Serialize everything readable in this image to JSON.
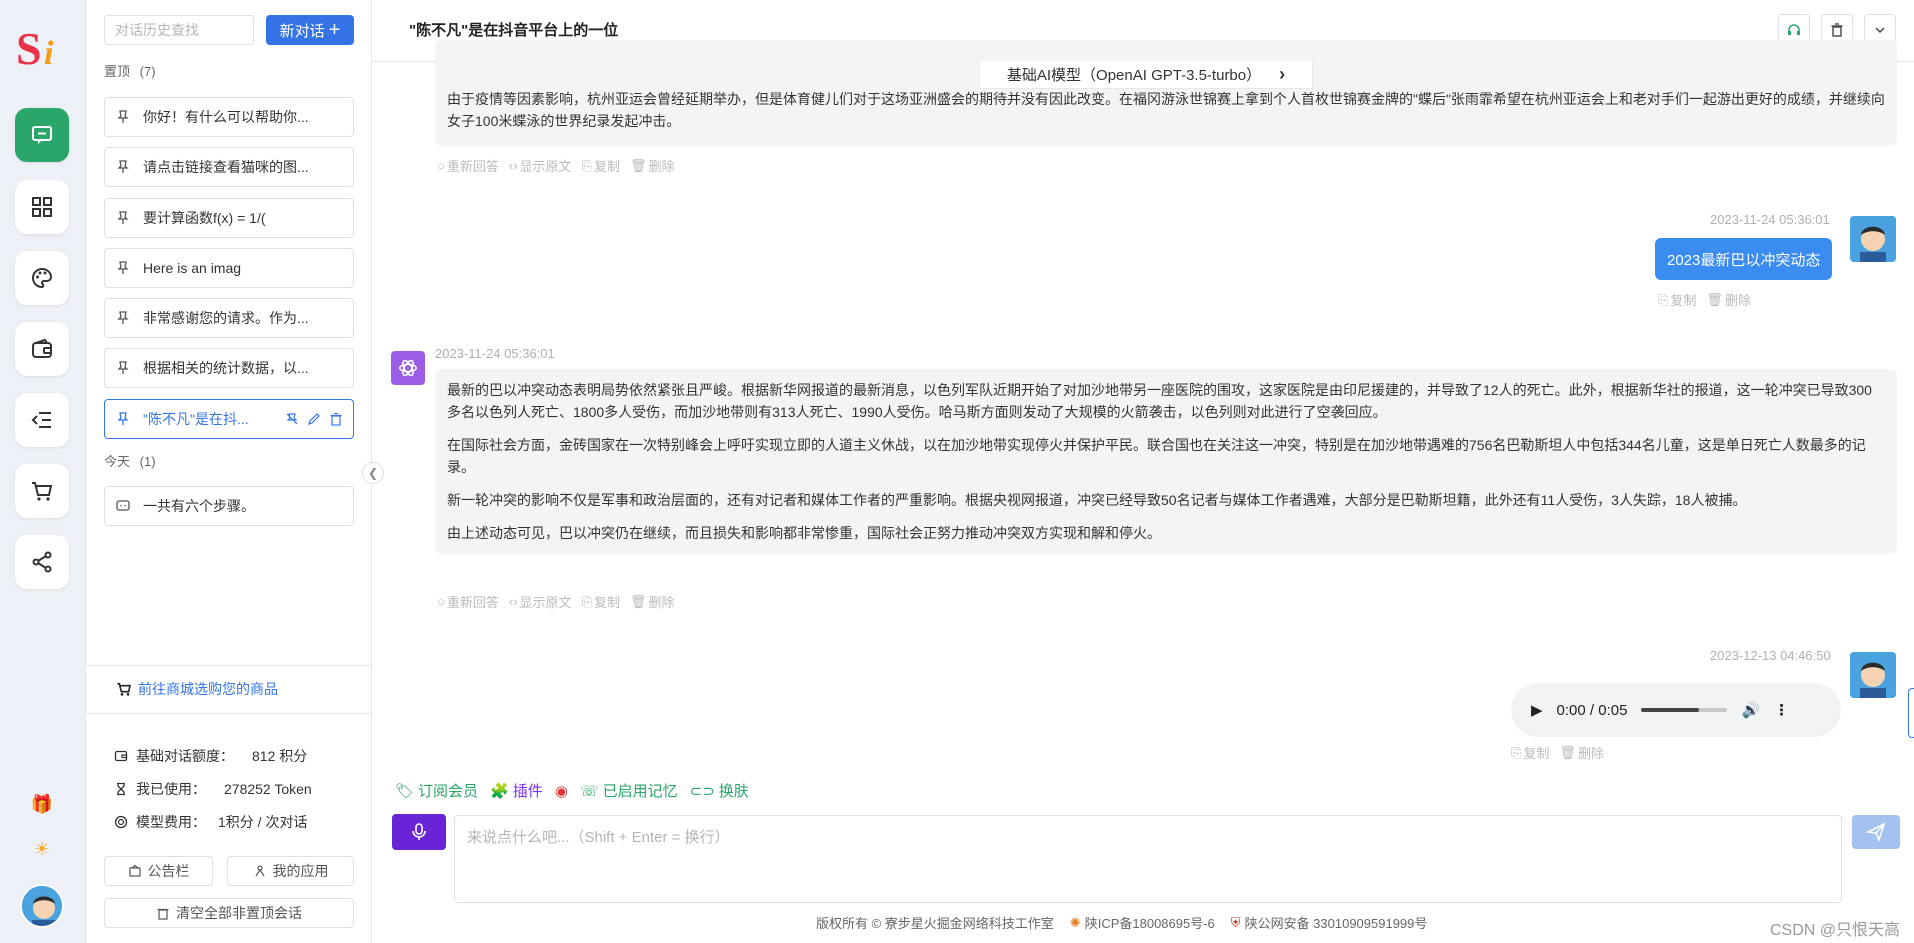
{
  "sidebar": {
    "search_placeholder": "对话历史查找",
    "new_chat_label": "新对话",
    "pinned_label": "置顶",
    "pinned_count": "(7)",
    "pinned": [
      "你好！有什么可以帮助你...",
      "请点击链接查看猫咪的图...",
      "要计算函数f(x) = 1/(",
      "Here is an imag",
      "非常感谢您的请求。作为...",
      "根据相关的统计数据，以...",
      "\"陈不凡\"是在抖..."
    ],
    "today_label": "今天",
    "today_count": "(1)",
    "today": [
      "一共有六个步骤。"
    ],
    "shop_link": "前往商城选购您的商品",
    "quota_label": "基础对话额度：",
    "quota_value": "812 积分",
    "used_label": "我已使用：",
    "used_value": "278252 Token",
    "fee_label": "模型费用：",
    "fee_value": "1积分 / 次对话",
    "notice_btn": "公告栏",
    "apps_btn": "我的应用",
    "clear_btn": "清空全部非置顶会话"
  },
  "header": {
    "title": "\"陈不凡\"是在抖音平台上的一位",
    "model": "基础AI模型（OpenAI GPT-3.5-turbo）"
  },
  "chat": {
    "msg1_partial": "由于疫情等因素影响，杭州亚运会曾经延期举办，但是体育健儿们对于这场亚洲盛会的期待并没有因此改变。在福冈游泳世锦赛上拿到个人首枚世锦赛金牌的\"蝶后\"张雨霏希望在杭州亚运会上和老对手们一起游出更好的成绩，并继续向女子100米蝶泳的世界纪录发起冲击。",
    "bot_actions": {
      "regen": "重新回答",
      "raw": "显示原文",
      "copy": "复制",
      "delete": "删除"
    },
    "user_actions": {
      "copy": "复制",
      "delete": "删除"
    },
    "user1_ts": "2023-11-24 05:36:01",
    "user1_text": "2023最新巴以冲突动态",
    "bot2_ts": "2023-11-24 05:36:01",
    "bot2_paras": [
      "最新的巴以冲突动态表明局势依然紧张且严峻。根据新华网报道的最新消息，以色列军队近期开始了对加沙地带另一座医院的围攻，这家医院是由印尼援建的，并导致了12人的死亡。此外，根据新华社的报道，这一轮冲突已导致300多名以色列人死亡、1800多人受伤，而加沙地带则有313人死亡、1990人受伤。哈马斯方面则发动了大规模的火箭袭击，以色列则对此进行了空袭回应。",
      "在国际社会方面，金砖国家在一次特别峰会上呼吁实现立即的人道主义休战，以在加沙地带实现停火并保护平民。联合国也在关注这一冲突，特别是在加沙地带遇难的756名巴勒斯坦人中包括344名儿童，这是单日死亡人数最多的记录。",
      "新一轮冲突的影响不仅是军事和政治层面的，还有对记者和媒体工作者的严重影响。根据央视网报道，冲突已经导致50名记者与媒体工作者遇难，大部分是巴勒斯坦籍，此外还有11人受伤，3人失踪，18人被捕。",
      "由上述动态可见，巴以冲突仍在继续，而且损失和影响都非常惨重，国际社会正努力推动冲突双方实现和解和停火。"
    ],
    "user2_ts": "2023-12-13 04:46:50",
    "audio_time": "0:00 / 0:05",
    "audio_progress": 0.67
  },
  "toolbar": {
    "subscribe": "订阅会员",
    "plugin": "插件",
    "memory": "已启用记忆",
    "skin": "换肤"
  },
  "input": {
    "placeholder": "来说点什么吧...（Shift + Enter = 换行）"
  },
  "footer": {
    "copyright": "版权所有 © 寮步星火掘金网络科技工作室",
    "icp": "陕ICP备18008695号-6",
    "police": "陕公网安备 33010909591999号",
    "watermark": "CSDN @只恨天高"
  }
}
